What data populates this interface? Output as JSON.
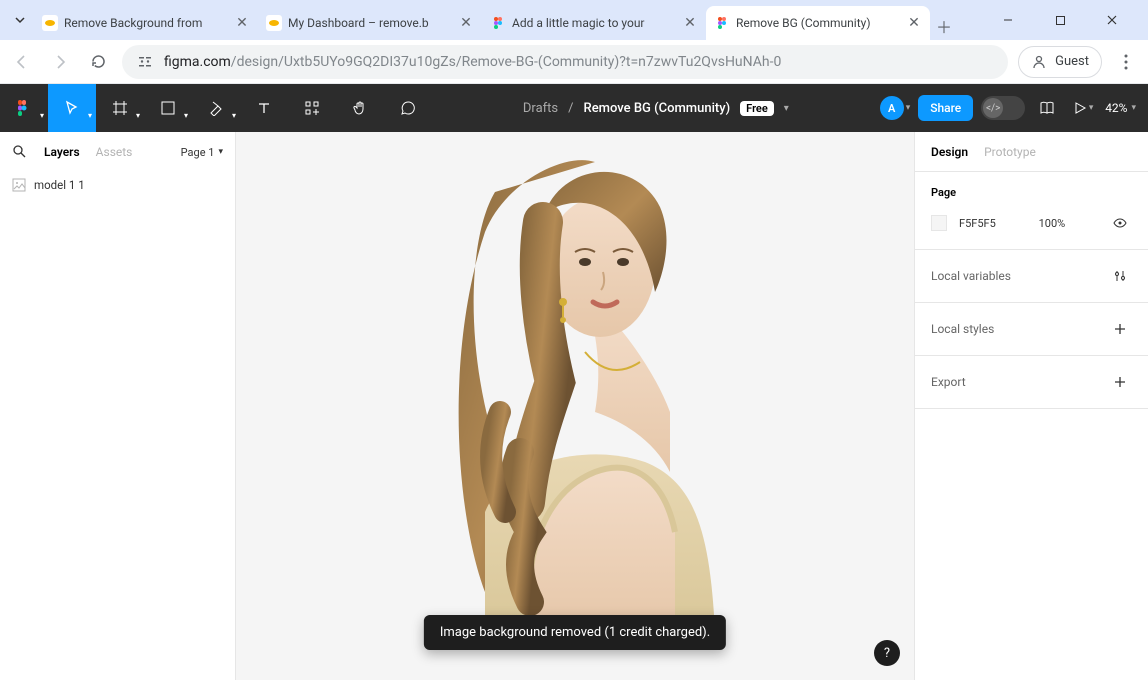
{
  "browser": {
    "tabs": [
      {
        "title": "Remove Background from",
        "favicon_color": "#f7b500"
      },
      {
        "title": "My Dashboard – remove.b",
        "favicon_color": "#f7b500"
      },
      {
        "title": "Add a little magic to your",
        "favicon_color": "#a259ff"
      },
      {
        "title": "Remove BG (Community)",
        "favicon_color": "#a259ff",
        "active": true
      }
    ],
    "url_host": "figma.com",
    "url_path": "/design/Uxtb5UYo9GQ2DI37u10gZs/Remove-BG-(Community)?t=n7zwvTu2QvsHuNAh-0",
    "guest_label": "Guest"
  },
  "figma": {
    "breadcrumb_parent": "Drafts",
    "breadcrumb_title": "Remove BG (Community)",
    "free_badge": "Free",
    "avatar_letter": "A",
    "share_label": "Share",
    "zoom_label": "42%",
    "left_panel": {
      "layers_tab": "Layers",
      "assets_tab": "Assets",
      "page_label": "Page 1",
      "layer_name": "model 1 1"
    },
    "right_panel": {
      "design_tab": "Design",
      "prototype_tab": "Prototype",
      "page_heading": "Page",
      "fill_hex": "F5F5F5",
      "fill_opacity": "100%",
      "local_variables": "Local variables",
      "local_styles": "Local styles",
      "export_label": "Export"
    },
    "toast": "Image background removed (1 credit charged)."
  }
}
